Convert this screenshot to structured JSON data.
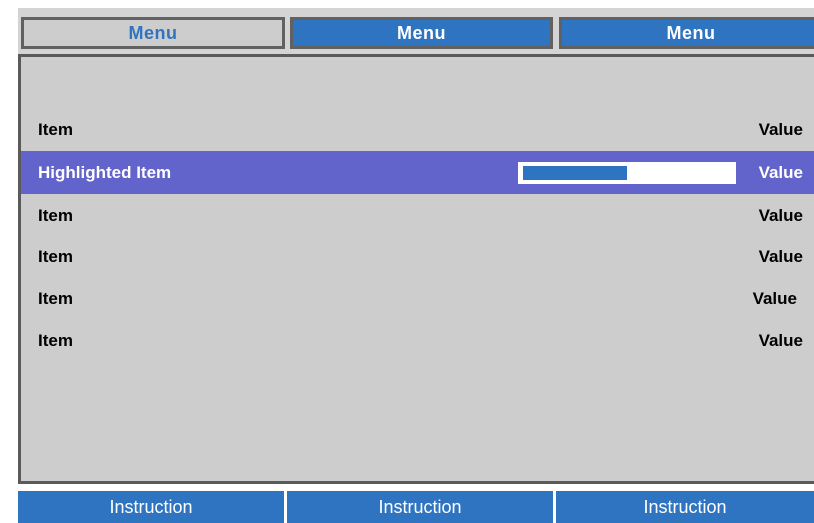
{
  "tabs": [
    {
      "label": "Menu",
      "active": true
    },
    {
      "label": "Menu",
      "active": false
    },
    {
      "label": "Menu",
      "active": false
    }
  ],
  "menu_items": [
    {
      "label": "Item",
      "value": "Value"
    },
    {
      "label": "Highlighted Item",
      "value": "Value",
      "highlighted": true,
      "slider_level": 0.5
    },
    {
      "label": "Item",
      "value": "Value"
    },
    {
      "label": "Item",
      "value": "Value"
    },
    {
      "label": "Item",
      "value": "Value"
    },
    {
      "label": "Item",
      "value": "Value"
    }
  ],
  "footer": {
    "instructions": [
      "Instruction",
      "Instruction",
      "Instruction"
    ]
  },
  "colors": {
    "accent": "#2f74c0",
    "highlight": "#6364cb",
    "panel": "#cdcdcd",
    "border": "#5a5a5a"
  }
}
